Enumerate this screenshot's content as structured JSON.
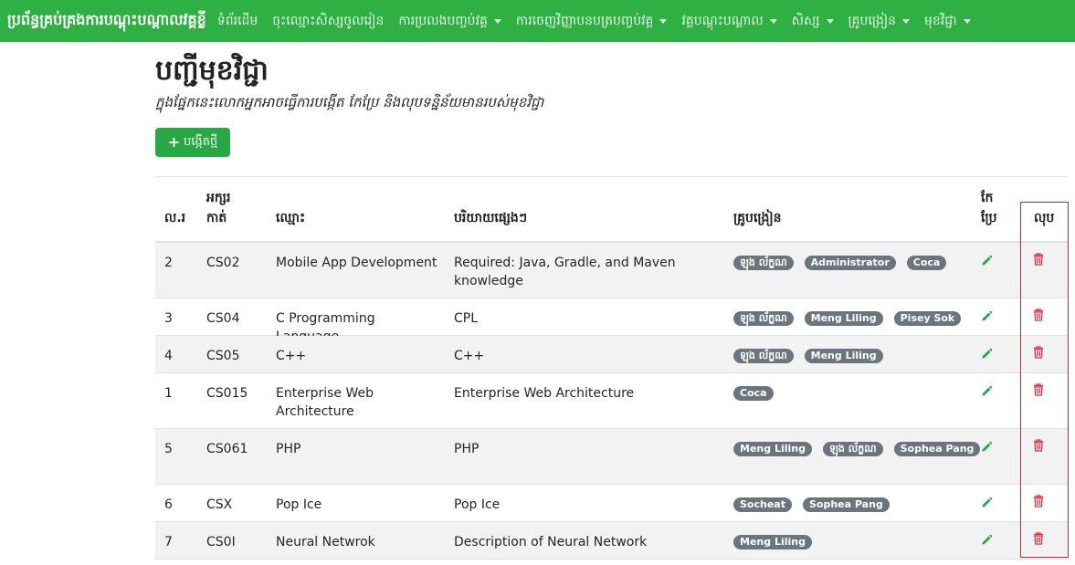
{
  "navbar": {
    "brand": "ប្រព័ន្ធគ្រប់គ្រងការបណ្តុះបណ្តាលវគ្គខ្លី",
    "items": [
      {
        "label": "ទំព័រដើម",
        "dropdown": false
      },
      {
        "label": "ចុះឈ្មោះសិស្សចូលរៀន",
        "dropdown": false
      },
      {
        "label": "ការប្រលងបញ្ចប់វគ្គ",
        "dropdown": true
      },
      {
        "label": "ការចេញវិញ្ញាបនបត្របញ្ចប់វគ្គ",
        "dropdown": true
      },
      {
        "label": "វគ្គបណ្តុះបណ្តាល",
        "dropdown": true
      },
      {
        "label": "សិស្ស",
        "dropdown": true
      },
      {
        "label": "គ្រូបង្រៀន",
        "dropdown": true
      },
      {
        "label": "មុខវិជ្ជា",
        "dropdown": true
      }
    ]
  },
  "page": {
    "title": "បញ្ជីមុខវិជ្ជា",
    "subtitle": "ក្នុងផ្នែកនេះលោកអ្នកអាចធ្វើការបង្កើត កែប្រែ និងលុបទន្និន័យមានរបស់មុខវិជ្ជា",
    "create_button": "បង្កើតថ្មី"
  },
  "table": {
    "headers": {
      "no": "ល.រ",
      "code_line1": "អក្សរ",
      "code_line2": "កាត់",
      "name": "ឈ្មោះ",
      "description": "បរិយាយផ្សេងៗ",
      "teachers": "គ្រូបង្រៀន",
      "edit_line1": "កែ",
      "edit_line2": "ប្រែ",
      "delete": "លុប"
    },
    "rows": [
      {
        "no": "2",
        "code": "CS02",
        "name": "Mobile App Development",
        "description": "Required: Java, Gradle, and Maven knowledge",
        "teachers": [
          "ឡុង ល័ក្ខណ",
          "Administrator",
          "Coca"
        ]
      },
      {
        "no": "3",
        "code": "CS04",
        "name": "C Programming Language",
        "description": "CPL",
        "teachers": [
          "ឡុង ល័ក្ខណ",
          "Meng Liling",
          "Pisey Sok"
        ]
      },
      {
        "no": "4",
        "code": "CS05",
        "name": "C++",
        "description": "C++",
        "teachers": [
          "ឡុង ល័ក្ខណ",
          "Meng Liling"
        ]
      },
      {
        "no": "1",
        "code": "CS015",
        "name": "Enterprise Web Architecture",
        "description": "Enterprise Web Architecture",
        "teachers": [
          "Coca"
        ]
      },
      {
        "no": "5",
        "code": "CS061",
        "name": "PHP",
        "description": "PHP",
        "teachers": [
          "Meng Liling",
          "ឡុង ល័ក្ខណ",
          "Sophea Pang"
        ]
      },
      {
        "no": "6",
        "code": "CSX",
        "name": "Pop Ice",
        "description": "Pop Ice",
        "teachers": [
          "Socheat",
          "Sophea Pang"
        ]
      },
      {
        "no": "7",
        "code": "CS0I",
        "name": "Neural Netwrok",
        "description": "Description of Neural Network",
        "teachers": [
          "Meng Liling"
        ]
      }
    ]
  },
  "colors": {
    "navbar": "#2fb043",
    "button": "#28a745",
    "badge": "#6c757d",
    "edit_icon": "#28a745",
    "delete_icon": "#dc3545",
    "highlight_frame": "#d9262c"
  },
  "icons": {
    "create": "plus-icon",
    "edit": "pencil-icon",
    "delete": "trash-icon",
    "dropdown": "chevron-down-icon"
  }
}
